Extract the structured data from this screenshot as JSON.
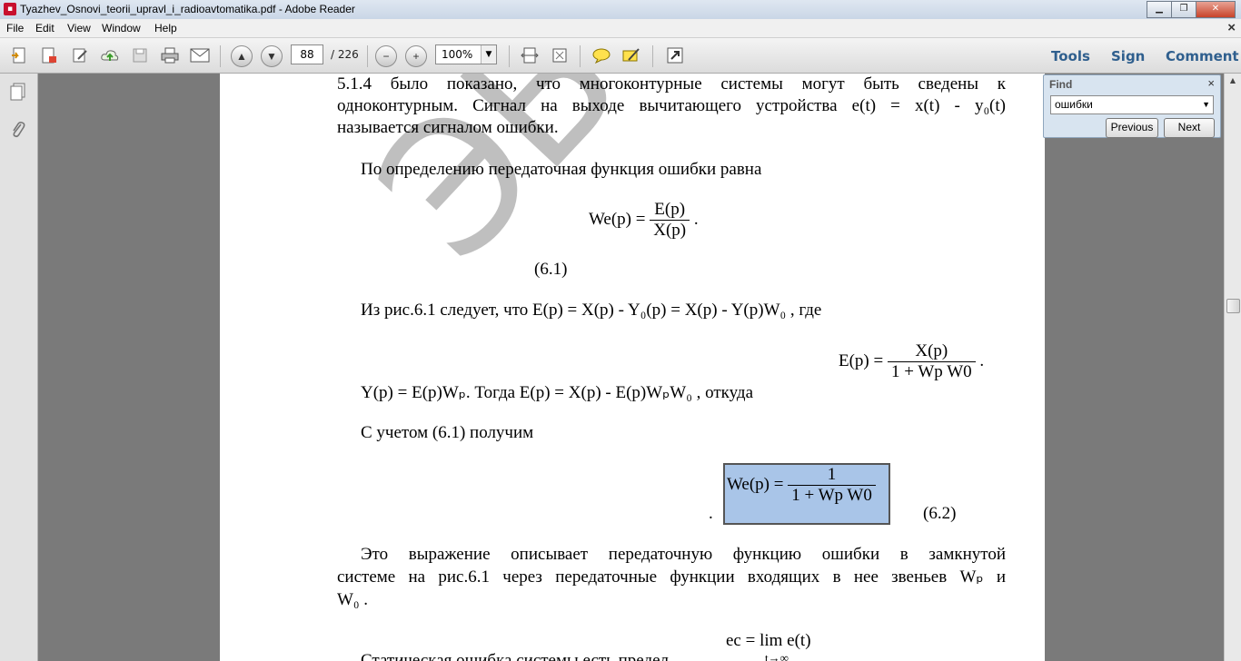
{
  "window": {
    "title": "Tyazhev_Osnovi_teorii_upravl_i_radioavtomatika.pdf - Adobe Reader",
    "minimize": "▁",
    "maximize": "❐",
    "close": "✕"
  },
  "menu": {
    "items": [
      "File",
      "Edit",
      "View",
      "Window",
      "Help"
    ],
    "close": "×"
  },
  "toolbar": {
    "page_current": "88",
    "page_total": "/ 226",
    "zoom": "100%",
    "tools": "Tools",
    "sign": "Sign",
    "comment": "Comment"
  },
  "find": {
    "label": "Find",
    "close": "×",
    "query": "ошибки",
    "previous": "Previous",
    "next": "Next"
  },
  "document": {
    "watermark": "ЭБС ПГУТИ",
    "p1_line1": "5.1.4 было показано, что многоконтурные системы могут быть сведены к",
    "p1_line2": "одноконтурным. Сигнал на выходе вычитающего устройства  e(t) = x(t) - y₀(t)",
    "p1_line3": "называется сигналом ошибки.",
    "p2": "По определению передаточная функция ошибки равна",
    "eq1_lhs": "We(p) =",
    "eq1_num": "E(p)",
    "eq1_den": "X(p)",
    "eq1_tail": ".",
    "eq1_label": "(6.1)",
    "p3": "Из рис.6.1 следует, что  E(p) = X(p) - Y₀(p) = X(p) - Y(p)W₀ ,  где",
    "eq2_lhs": "E(p) =",
    "eq2_num": "X(p)",
    "eq2_den": "1 + Wp W0",
    "eq2_tail": ".",
    "p4": "Y(p) = E(p)Wₚ.  Тогда   E(p) = X(p) - E(p)WₚW₀ ,   откуда",
    "p5": "С учетом (6.1) получим",
    "eq3_lhs": "We(p) =",
    "eq3_num": "1",
    "eq3_den": "1 + Wp W0",
    "eq3_tail": ".",
    "eq3_label": "(6.2)",
    "p6_line1": "Это выражение описывает передаточную функцию ошибки в замкнутой",
    "p6_line2": "системе на рис.6.1 через передаточные функции входящих в нее звеньев Wₚ  и",
    "p6_line3": "W₀ .",
    "eq4": "ec = lim e(t)",
    "eq4_sub": "t→∞",
    "p7": "Статическая ошибка системы есть предел"
  }
}
